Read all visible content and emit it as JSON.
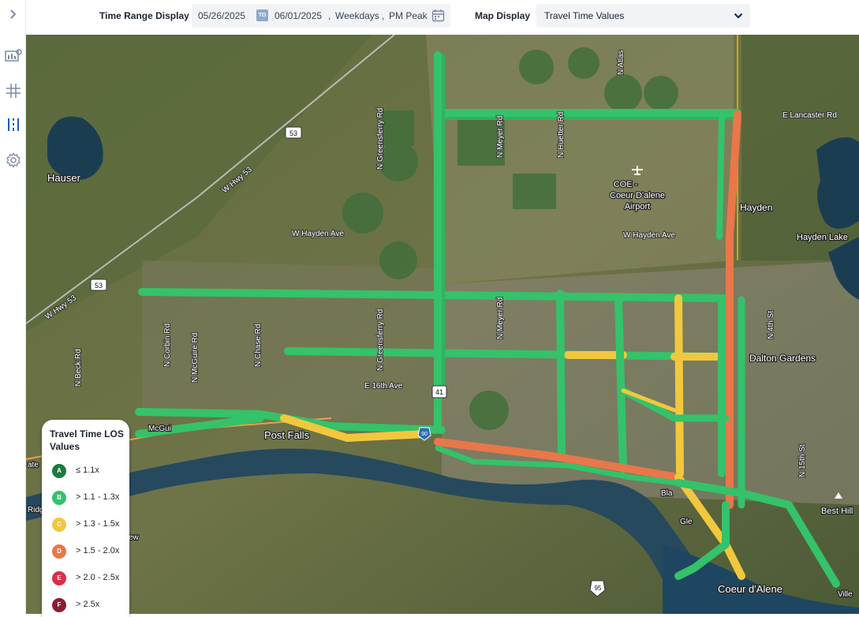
{
  "sidebar": {
    "items": [
      {
        "name": "chevron-right-icon"
      },
      {
        "name": "dashboard-icon"
      },
      {
        "name": "network-icon"
      },
      {
        "name": "corridor-icon",
        "active": true
      },
      {
        "name": "gear-icon"
      }
    ]
  },
  "toolbar": {
    "time_range_label": "Time Range Display",
    "start_date": "05/26/2025",
    "to_badge": "TO",
    "end_date": "06/01/2025",
    "day_type": "Weekdays",
    "period": "PM Peak",
    "map_display_label": "Map Display",
    "map_display_value": "Travel Time Values"
  },
  "map": {
    "places": [
      "Hauser",
      "Hayden",
      "Hayden Lake",
      "Dalton Gardens",
      "Post Falls",
      "Coeur d'Alene",
      "Best Hill",
      "COE -",
      "Coeur D'alene",
      "Airport",
      "McGui",
      "Ridge",
      "ate",
      "Bla",
      "Gle",
      "Ville",
      "ew"
    ],
    "roads": [
      "W Hayden Ave",
      "W Hayden Ave",
      "E Lancaster Rd",
      "E 16th Ave",
      "W Hwy 53",
      "W Hwy 53",
      "N Greensferry Rd",
      "N Greensferry Rd",
      "N Meyer Rd",
      "N Meyer Rd",
      "N Huetter Rd",
      "N Atlas",
      "N Beck Rd",
      "N Corbin Rd",
      "N McGuire Rd",
      "N Chase Rd",
      "N 4th St",
      "N 15th St"
    ],
    "shields": [
      "53",
      "53",
      "41",
      "95",
      "90"
    ]
  },
  "legend": {
    "title": "Travel Time LOS Values",
    "items": [
      {
        "grade": "A",
        "label": "≤ 1.1x",
        "color": "#1b7a3d"
      },
      {
        "grade": "B",
        "label": "> 1.1 - 1.3x",
        "color": "#34c26a"
      },
      {
        "grade": "C",
        "label": "> 1.3 - 1.5x",
        "color": "#f1c83d"
      },
      {
        "grade": "D",
        "label": "> 1.5 - 2.0x",
        "color": "#e8774a"
      },
      {
        "grade": "E",
        "label": "> 2.0 - 2.5x",
        "color": "#d92f4a"
      },
      {
        "grade": "F",
        "label": "> 2.5x",
        "color": "#8e1b33"
      }
    ]
  },
  "colors": {
    "los_b": "#34c26a",
    "los_c": "#f1c83d",
    "los_d": "#e8774a",
    "accent": "#1a5fb4"
  }
}
